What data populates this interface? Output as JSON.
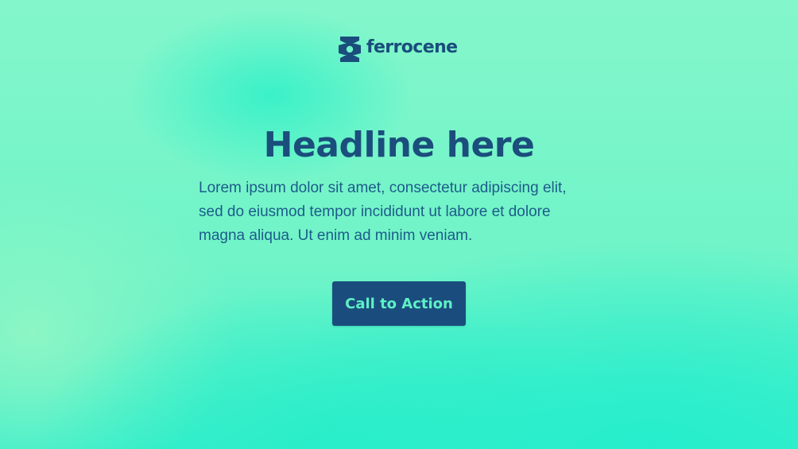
{
  "brand": {
    "name": "ferrocene",
    "logo_icon": "ferrocene-logo-icon",
    "color": "#1a4d7c"
  },
  "hero": {
    "headline": "Headline here",
    "body": "Lorem ipsum dolor sit amet, consectetur adipiscing elit, sed do eiusmod tempor incididunt ut labore et dolore magna aliqua. Ut enim ad minim veniam.",
    "cta_label": "Call to Action"
  },
  "colors": {
    "background": "#7ef5c9",
    "accent": "#2ef0c8",
    "button_bg": "#1a4d7e",
    "button_text": "#5ff0c6",
    "headline": "#1b4e7c"
  }
}
